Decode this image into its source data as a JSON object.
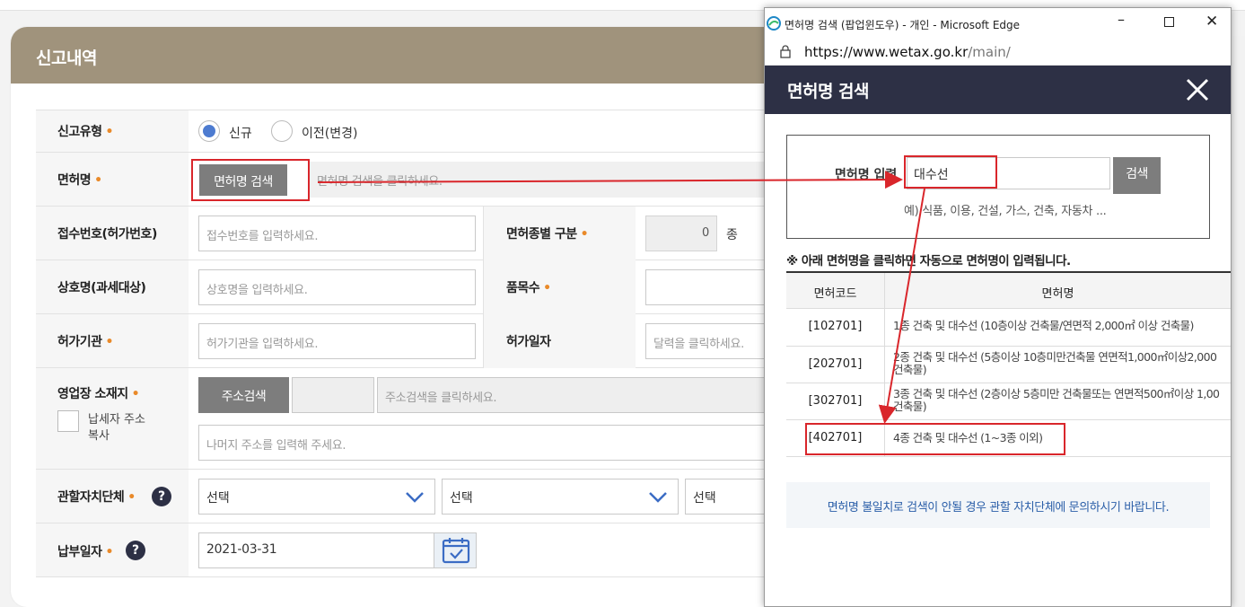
{
  "form": {
    "title": "신고내역",
    "report_type": {
      "label": "신고유형",
      "options": [
        "신규",
        "이전(변경)"
      ]
    },
    "license": {
      "label": "면허명",
      "button": "면허명 검색",
      "placeholder": "면허명 검색을 클릭하세요."
    },
    "receipt_no": {
      "label": "접수번호(허가번호)",
      "placeholder": "접수번호를 입력하세요."
    },
    "license_kind": {
      "label": "면허종별 구분",
      "value": "0",
      "unit": "종"
    },
    "business_name": {
      "label": "상호명(과세대상)",
      "placeholder": "상호명을 입력하세요."
    },
    "item_count": {
      "label": "품목수"
    },
    "agency": {
      "label": "허가기관",
      "placeholder": "허가기관을 입력하세요."
    },
    "permit_date": {
      "label": "허가일자",
      "placeholder": "달력을 클릭하세요."
    },
    "location": {
      "label": "영업장 소재지",
      "copy_label": "납세자 주소 복사",
      "button": "주소검색",
      "placeholder": "주소검색을 클릭하세요.",
      "detail_placeholder": "나머지 주소를 입력해 주세요."
    },
    "jurisdiction": {
      "label": "관할자치단체",
      "selects": [
        "선택",
        "선택",
        "선택"
      ]
    },
    "payment_date": {
      "label": "납부일자",
      "value": "2021-03-31"
    }
  },
  "popup": {
    "window_title": "면허명 검색 (팝업윈도우) - 개인 - Microsoft Edge",
    "url_base": "https://www.wetax.go.kr",
    "url_path": "/main/",
    "header": "면허명 검색",
    "search_label": "면허명 입력",
    "search_value": "대수선",
    "search_button": "검색",
    "hint": "예) 식품, 이용, 건설, 가스, 건축, 자동차 ...",
    "instruction": "※ 아래 면허명을 클릭하면 자동으로 면허명이 입력됩니다.",
    "columns": [
      "면허코드",
      "면허명"
    ],
    "rows": [
      {
        "code": "[102701]",
        "name": "1종 건축 및 대수선 (10층이상 건축물/연면적 2,000㎡ 이상 건축물)",
        "name2": ""
      },
      {
        "code": "[202701]",
        "name": "2종 건축 및 대수선 (5층이상 10층미만건축물 연면적1,000㎡이상2,000",
        "name2": "건축물)"
      },
      {
        "code": "[302701]",
        "name": "3종 건축 및 대수선 (2층이상 5층미만 건축물또는 연면적500㎡이상 1,00",
        "name2": "건축물)"
      },
      {
        "code": "[402701]",
        "name": "4종 건축 및 대수선 (1~3종 이외)",
        "name2": ""
      }
    ],
    "footer_note": "면허명 불일치로 검색이 안될 경우 관할 자치단체에 문의하시기 바랍니다."
  },
  "colors": {
    "header_brown": "#a0937c",
    "popup_navy": "#2d3045",
    "highlight_red": "#d9262b",
    "required_orange": "#e98a2a"
  }
}
